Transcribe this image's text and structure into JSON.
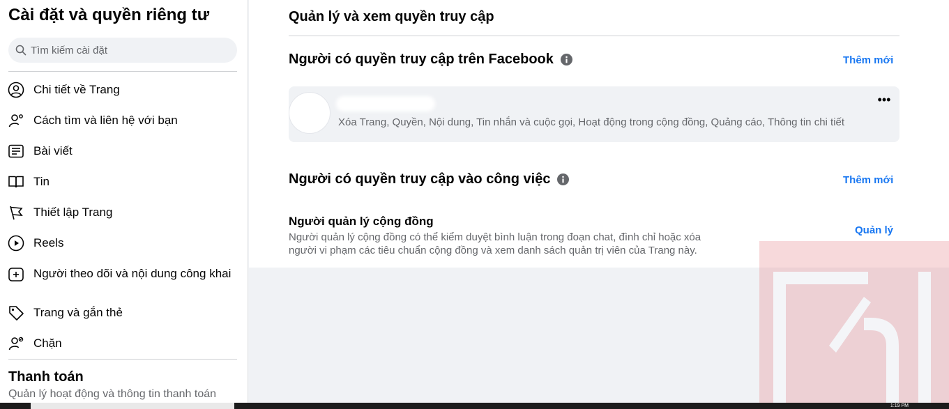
{
  "sidebar": {
    "title": "Cài đặt và quyền riêng tư",
    "search_placeholder": "Tìm kiếm cài đặt",
    "items": [
      {
        "label": "Chi tiết về Trang",
        "icon": "user-circle-icon"
      },
      {
        "label": "Cách tìm và liên hệ với bạn",
        "icon": "user-search-icon"
      },
      {
        "label": "Bài viết",
        "icon": "posts-icon"
      },
      {
        "label": "Tin",
        "icon": "book-icon"
      },
      {
        "label": "Thiết lập Trang",
        "icon": "flag-icon"
      },
      {
        "label": "Reels",
        "icon": "reels-icon"
      },
      {
        "label": "Người theo dõi và nội dung công khai",
        "icon": "add-box-icon"
      },
      {
        "label": "Trang và gắn thẻ",
        "icon": "tag-icon"
      },
      {
        "label": "Chặn",
        "icon": "block-user-icon"
      }
    ],
    "payments_title": "Thanh toán",
    "payments_subtitle": "Quản lý hoạt động và thông tin thanh toán"
  },
  "main": {
    "title": "Quản lý và xem quyền truy cập",
    "facebook_access": {
      "heading": "Người có quyền truy cập trên Facebook",
      "add_label": "Thêm mới",
      "permissions": "Xóa Trang, Quyền, Nội dung, Tin nhắn và cuộc gọi, Hoạt động trong cộng đồng, Quảng cáo, Thông tin chi tiết",
      "more_label": "•••"
    },
    "task_access": {
      "heading": "Người có quyền truy cập vào công việc",
      "add_label": "Thêm mới",
      "community_manager_title": "Người quản lý cộng đồng",
      "community_manager_desc": "Người quản lý cộng đồng có thể kiểm duyệt bình luận trong đoạn chat, đình chỉ hoặc xóa người vi phạm các tiêu chuẩn cộng đồng và xem danh sách quản trị viên của Trang này.",
      "manage_label": "Quản lý"
    }
  },
  "taskbar": {
    "time": "1:19 PM"
  },
  "colors": {
    "link": "#1877f2",
    "muted": "#65676b",
    "bg": "#f0f2f5"
  }
}
